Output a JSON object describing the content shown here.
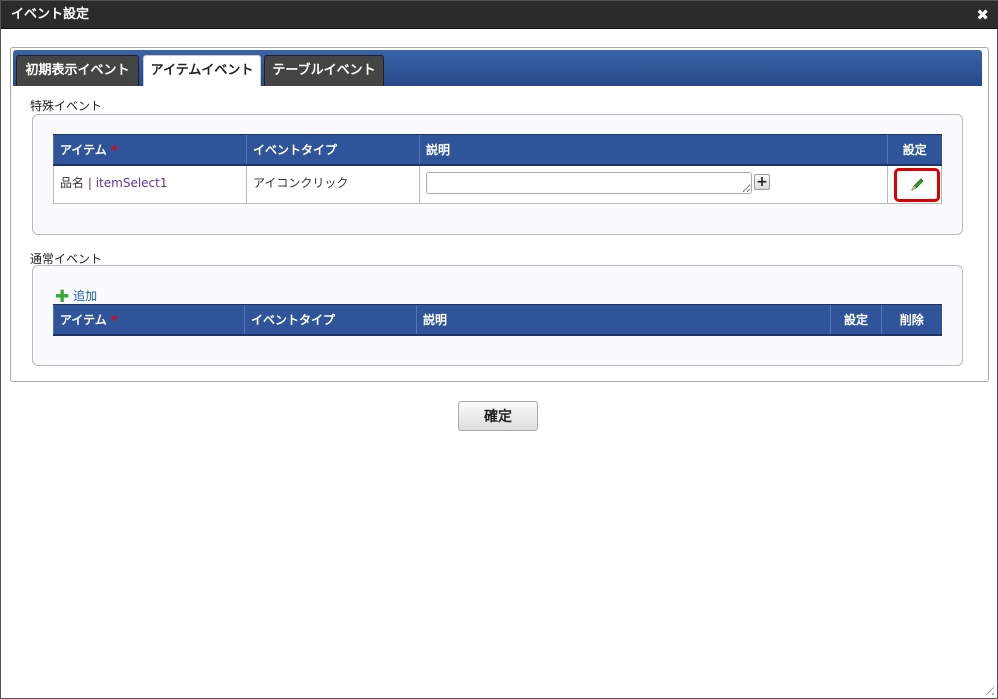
{
  "window": {
    "title": "イベント設定",
    "close_icon": "close-icon"
  },
  "tabs": [
    {
      "label": "初期表示イベント"
    },
    {
      "label": "アイテムイベント",
      "active": true
    },
    {
      "label": "テーブルイベント"
    }
  ],
  "special": {
    "legend": "特殊イベント",
    "headers": {
      "item": "アイテム",
      "required": "*",
      "event_type": "イベントタイプ",
      "description": "説明",
      "settings": "設定"
    },
    "rows": [
      {
        "item_name": "品名",
        "separator": "|",
        "item_id": "itemSelect1",
        "event_type": "アイコンクリック",
        "description": ""
      }
    ]
  },
  "normal": {
    "legend": "通常イベント",
    "add_label": "追加",
    "headers": {
      "item": "アイテム",
      "required": "*",
      "event_type": "イベントタイプ",
      "description": "説明",
      "settings": "設定",
      "delete": "削除"
    }
  },
  "confirm_label": "確定",
  "close_glyph": "✖",
  "plus_glyph": "+"
}
